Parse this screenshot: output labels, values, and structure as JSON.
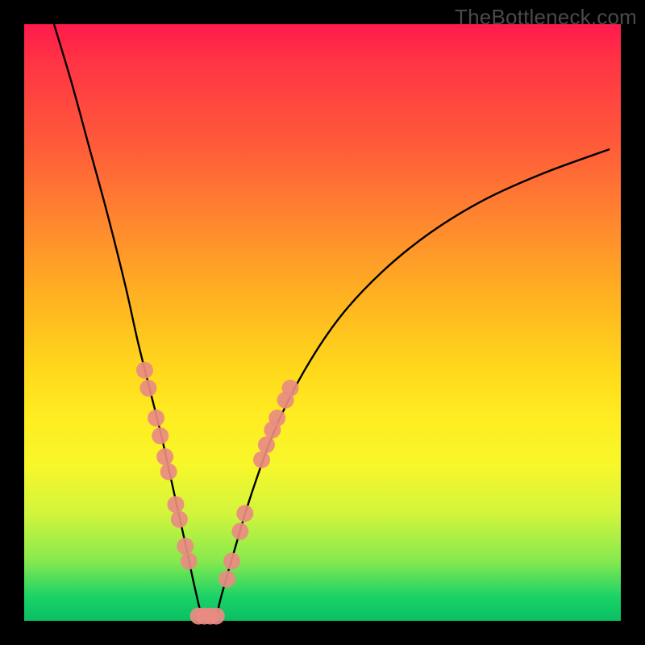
{
  "watermark": "TheBottleneck.com",
  "chart_data": {
    "type": "line",
    "title": "",
    "xlabel": "",
    "ylabel": "",
    "xlim": [
      0,
      100
    ],
    "ylim": [
      0,
      100
    ],
    "grid": false,
    "legend": false,
    "series": [
      {
        "name": "bottleneck-curve",
        "color": "#000000",
        "x": [
          5,
          8,
          11,
          14,
          17,
          19,
          21,
          23,
          25,
          27,
          28.5,
          30,
          31,
          32,
          33,
          35,
          38,
          42,
          47,
          53,
          60,
          68,
          77,
          87,
          98
        ],
        "y": [
          100,
          90,
          79,
          68,
          56,
          47,
          39,
          31,
          22,
          13,
          6,
          0,
          0,
          0,
          4,
          11,
          21,
          32,
          42,
          51,
          58.5,
          65,
          70.5,
          75,
          79
        ]
      }
    ],
    "scatter_overlay": {
      "name": "sample-points",
      "color": "#e98b82",
      "points": [
        {
          "x": 20.2,
          "y": 42
        },
        {
          "x": 20.8,
          "y": 39
        },
        {
          "x": 22.1,
          "y": 34
        },
        {
          "x": 22.8,
          "y": 31
        },
        {
          "x": 23.6,
          "y": 27.5
        },
        {
          "x": 24.2,
          "y": 25
        },
        {
          "x": 25.4,
          "y": 19.5
        },
        {
          "x": 26.0,
          "y": 17
        },
        {
          "x": 27.0,
          "y": 12.5
        },
        {
          "x": 27.6,
          "y": 10
        },
        {
          "x": 29.2,
          "y": 0.8
        },
        {
          "x": 30.2,
          "y": 0.8
        },
        {
          "x": 31.2,
          "y": 0.8
        },
        {
          "x": 32.2,
          "y": 0.8
        },
        {
          "x": 34.0,
          "y": 7
        },
        {
          "x": 34.8,
          "y": 10
        },
        {
          "x": 36.2,
          "y": 15
        },
        {
          "x": 37.0,
          "y": 18
        },
        {
          "x": 39.8,
          "y": 27
        },
        {
          "x": 40.6,
          "y": 29.5
        },
        {
          "x": 41.6,
          "y": 32
        },
        {
          "x": 42.4,
          "y": 34
        },
        {
          "x": 43.8,
          "y": 37
        },
        {
          "x": 44.6,
          "y": 39
        }
      ]
    },
    "background_gradient": {
      "top": "#ff1a4d",
      "mid1": "#ff8a2e",
      "mid2": "#ffed22",
      "bottom": "#09bf63"
    }
  }
}
